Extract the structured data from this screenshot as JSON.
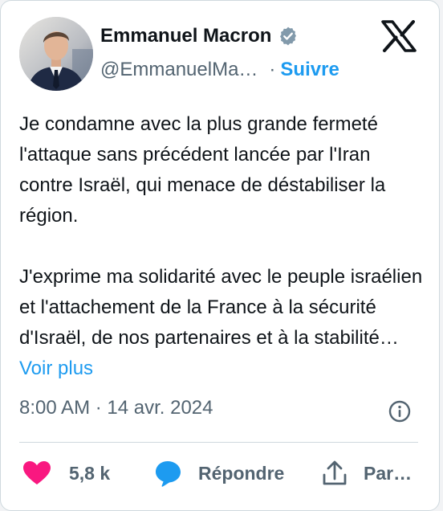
{
  "author": {
    "name": "Emmanuel Macron",
    "handle": "@EmmanuelMa…",
    "separator": "·",
    "follow_label": "Suivre"
  },
  "tweet": {
    "paragraph_1": "Je condamne avec la plus grande fermeté l'attaque sans précédent lancée par l'Iran contre Israël, qui menace de déstabiliser la région.",
    "paragraph_2": "J'exprime ma solidarité avec le peuple israélien et l'attachement de la France à la sécurité d'Israël, de nos partenaires et à la stabilité…",
    "more_label": "Voir plus"
  },
  "meta": {
    "timestamp": "8:00 AM · 14 avr. 2024"
  },
  "actions": {
    "like_count": "5,8 k",
    "reply_label": "Répondre",
    "share_label": "Par…"
  },
  "icons": {
    "verified": "verified-badge-icon",
    "logo": "x-logo-icon",
    "info": "info-icon",
    "like": "heart-icon",
    "reply": "reply-bubble-icon",
    "share": "share-icon"
  },
  "colors": {
    "text": "#0f1419",
    "secondary": "#536471",
    "accent": "#1d9bf0",
    "like": "#f91880",
    "border": "#cfd9de",
    "verified": "#829aab"
  }
}
